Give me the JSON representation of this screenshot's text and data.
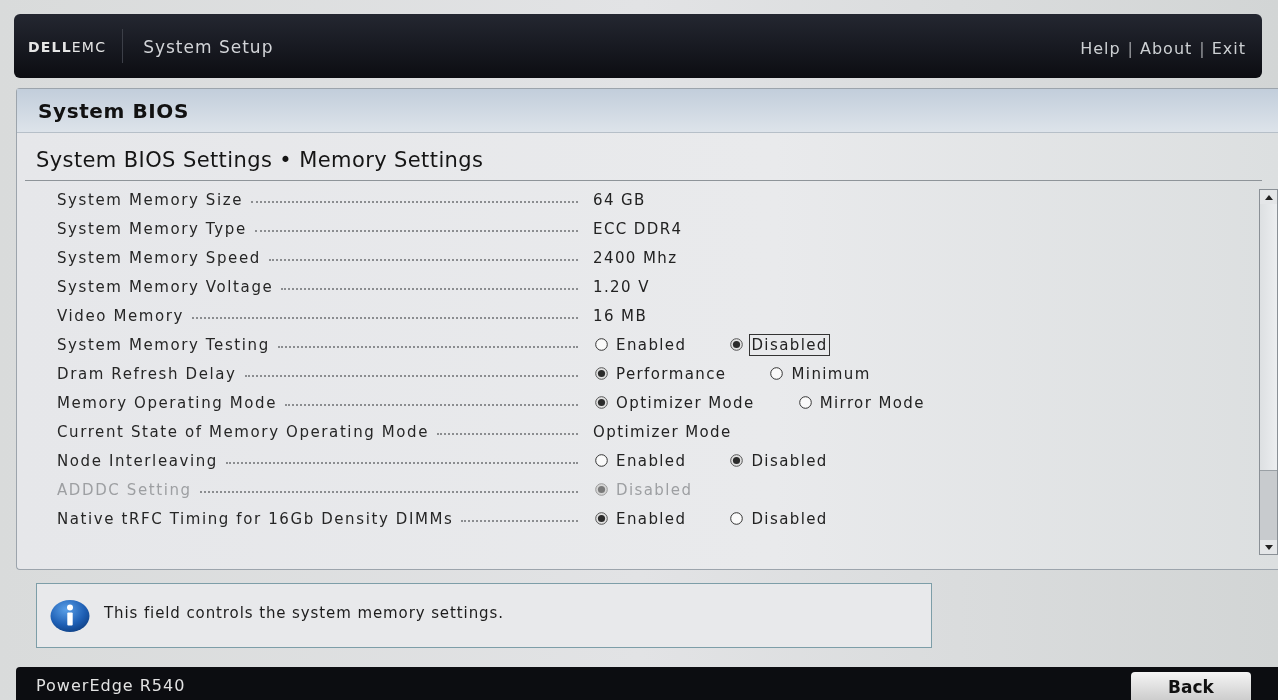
{
  "header": {
    "logo": "**DELL**EMC",
    "title": "System Setup",
    "links": [
      "Help",
      "About",
      "Exit"
    ],
    "link_separators": [
      "|",
      "|"
    ]
  },
  "page": {
    "title": "System BIOS",
    "breadcrumb": "System BIOS Settings • Memory Settings"
  },
  "settings": [
    {
      "label": "System Memory Size",
      "kind": "info",
      "disabled": false,
      "value": "64 GB"
    },
    {
      "label": "System Memory Type",
      "kind": "info",
      "disabled": false,
      "value": "ECC DDR4"
    },
    {
      "label": "System Memory Speed",
      "kind": "info",
      "disabled": false,
      "value": "2400 Mhz"
    },
    {
      "label": "System Memory Voltage",
      "kind": "info",
      "disabled": false,
      "value": "1.20 V"
    },
    {
      "label": "Video Memory",
      "kind": "info",
      "disabled": false,
      "value": "16 MB"
    },
    {
      "label": "System Memory Testing",
      "kind": "radio",
      "disabled": false,
      "options": [
        {
          "label": "Enabled",
          "selected": false,
          "focused": false
        },
        {
          "label": "Disabled",
          "selected": true,
          "focused": true
        }
      ]
    },
    {
      "label": "Dram Refresh Delay",
      "kind": "radio",
      "disabled": false,
      "options": [
        {
          "label": "Performance",
          "selected": true,
          "focused": false
        },
        {
          "label": "Minimum",
          "selected": false,
          "focused": false
        }
      ]
    },
    {
      "label": "Memory Operating Mode",
      "kind": "radio",
      "disabled": false,
      "options": [
        {
          "label": "Optimizer Mode",
          "selected": true,
          "focused": false
        },
        {
          "label": "Mirror Mode",
          "selected": false,
          "focused": false
        }
      ]
    },
    {
      "label": "Current State of Memory Operating Mode",
      "kind": "info",
      "disabled": false,
      "value": "Optimizer Mode"
    },
    {
      "label": "Node Interleaving",
      "kind": "radio",
      "disabled": false,
      "options": [
        {
          "label": "Enabled",
          "selected": false,
          "focused": false
        },
        {
          "label": "Disabled",
          "selected": true,
          "focused": false
        }
      ]
    },
    {
      "label": "ADDDC Setting",
      "kind": "radio",
      "disabled": true,
      "options": [
        {
          "label": "Disabled",
          "selected": true,
          "focused": false
        }
      ]
    },
    {
      "label": "Native tRFC Timing for 16Gb Density DIMMs",
      "kind": "radio",
      "disabled": false,
      "options": [
        {
          "label": "Enabled",
          "selected": true,
          "focused": false
        },
        {
          "label": "Disabled",
          "selected": false,
          "focused": false
        }
      ]
    }
  ],
  "help": {
    "text": "This field controls the system memory settings."
  },
  "footer": {
    "model": "PowerEdge R540",
    "button": "Back"
  }
}
